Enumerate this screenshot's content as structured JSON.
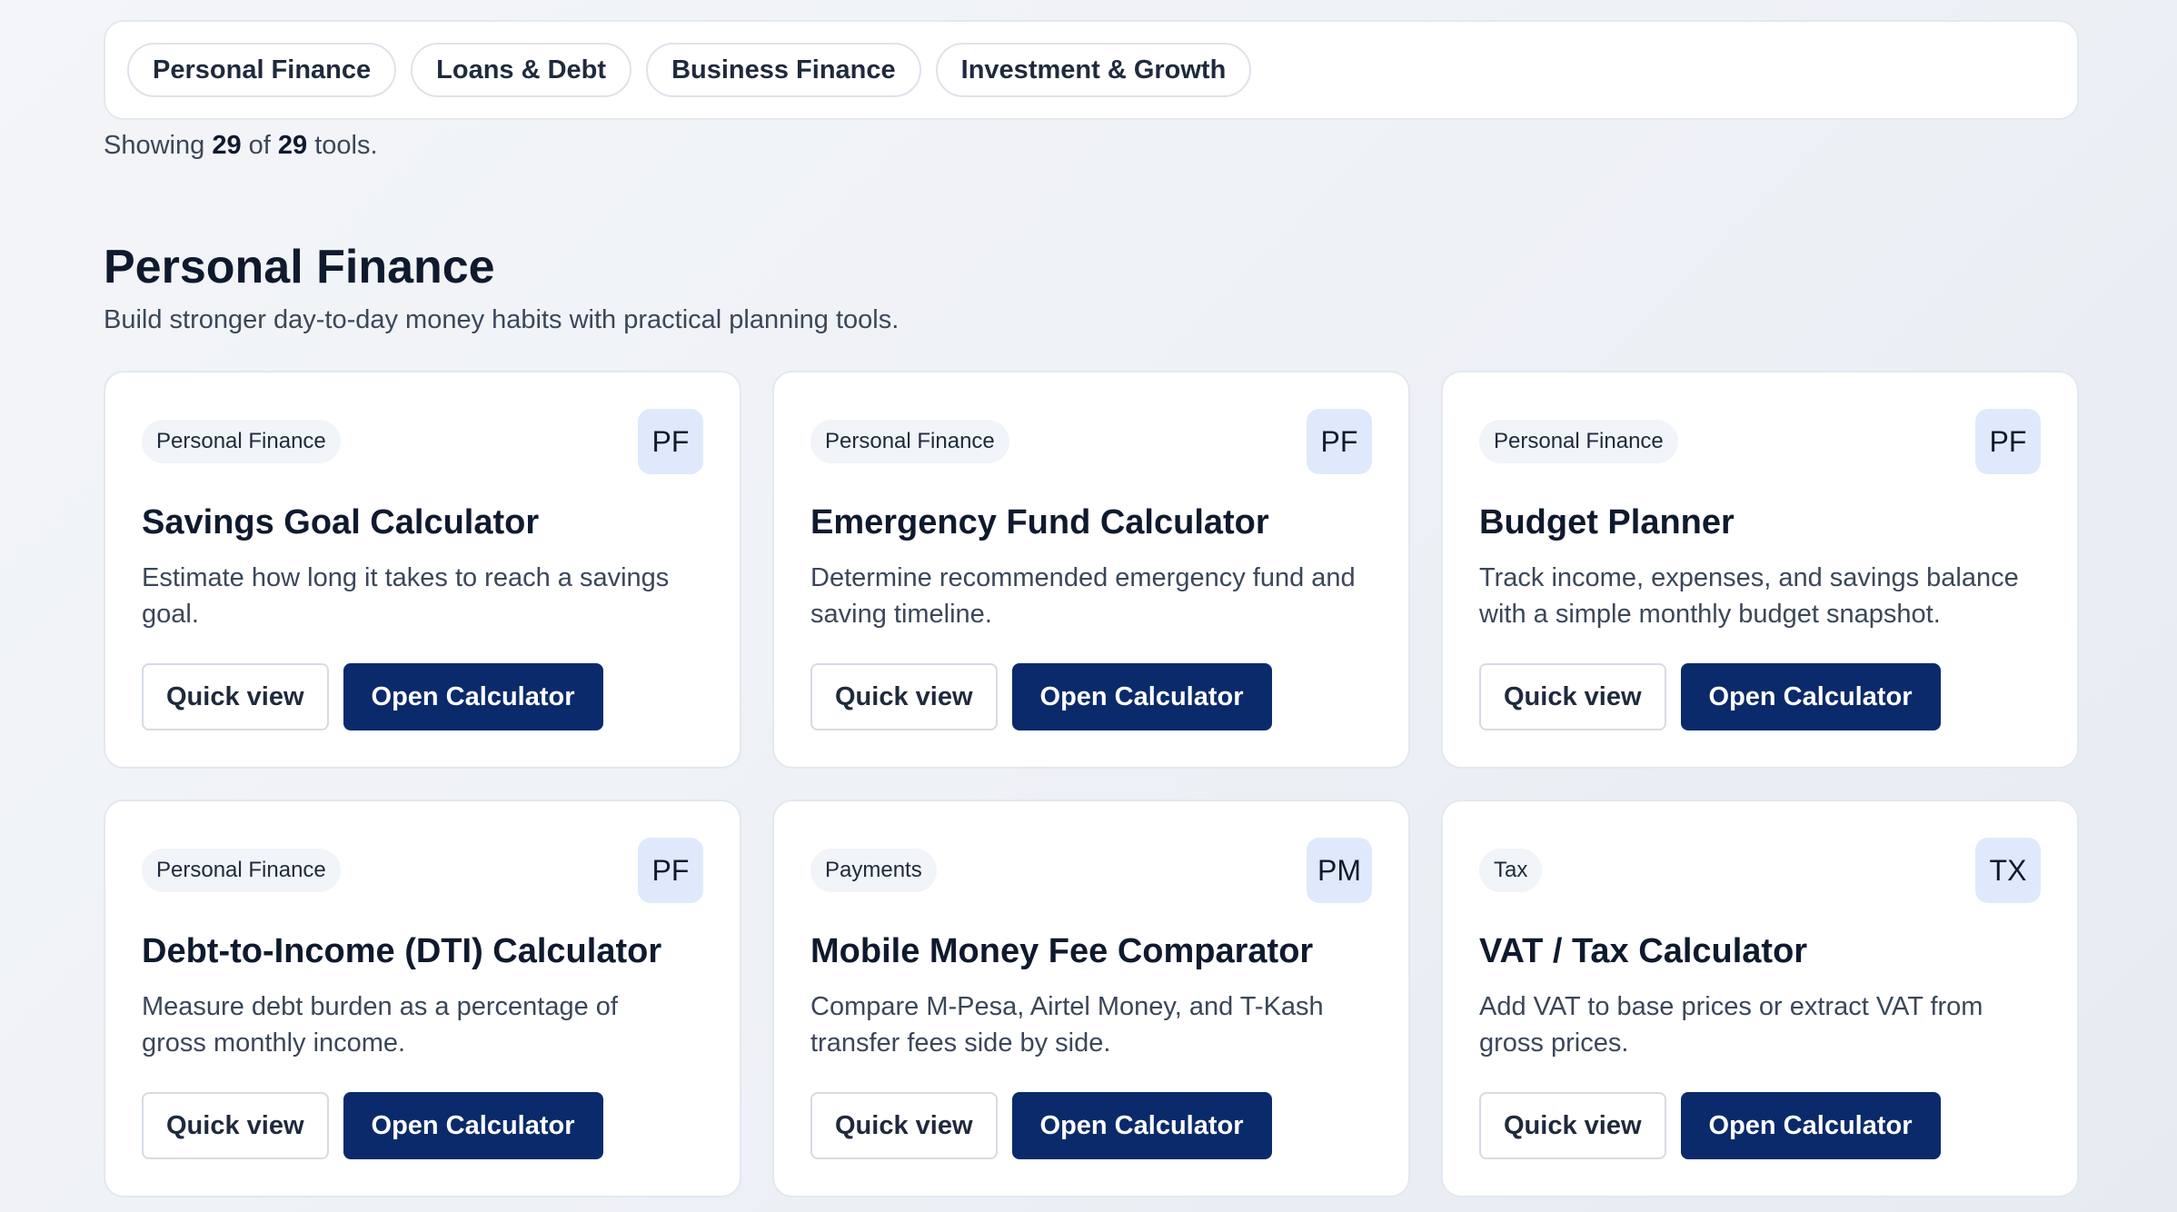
{
  "filters": [
    {
      "label": "Personal Finance"
    },
    {
      "label": "Loans & Debt"
    },
    {
      "label": "Business Finance"
    },
    {
      "label": "Investment & Growth"
    }
  ],
  "summary": {
    "prefix": "Showing",
    "shown": "29",
    "middle": "of",
    "total": "29",
    "suffix": "tools."
  },
  "section": {
    "title": "Personal Finance",
    "description": "Build stronger day-to-day money habits with practical planning tools."
  },
  "buttons": {
    "quick_view": "Quick view",
    "open": "Open Calculator"
  },
  "cards": [
    {
      "tag": "Personal Finance",
      "code": "PF",
      "title": "Savings Goal Calculator",
      "description": "Estimate how long it takes to reach a savings goal."
    },
    {
      "tag": "Personal Finance",
      "code": "PF",
      "title": "Emergency Fund Calculator",
      "description": "Determine recommended emergency fund and saving timeline."
    },
    {
      "tag": "Personal Finance",
      "code": "PF",
      "title": "Budget Planner",
      "description": "Track income, expenses, and savings balance with a simple monthly budget snapshot."
    },
    {
      "tag": "Personal Finance",
      "code": "PF",
      "title": "Debt-to-Income (DTI) Calculator",
      "description": "Measure debt burden as a percentage of gross monthly income."
    },
    {
      "tag": "Payments",
      "code": "PM",
      "title": "Mobile Money Fee Comparator",
      "description": "Compare M-Pesa, Airtel Money, and T-Kash transfer fees side by side."
    },
    {
      "tag": "Tax",
      "code": "TX",
      "title": "VAT / Tax Calculator",
      "description": "Add VAT to base prices or extract VAT from gross prices."
    }
  ]
}
